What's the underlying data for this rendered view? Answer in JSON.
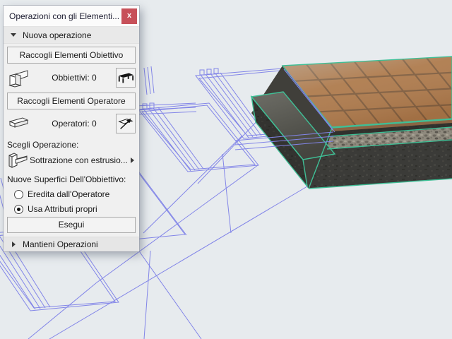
{
  "window": {
    "title": "Operazioni con gli Elementi...",
    "close_label": "x"
  },
  "panel": {
    "new_operation": {
      "header": "Nuova operazione",
      "collect_targets_button": "Raccogli Elementi Obiettivo",
      "targets_label": "Obbiettivi:",
      "targets_count": "0",
      "collect_operators_button": "Raccogli Elementi Operatore",
      "operators_label": "Operatori:",
      "operators_count": "0",
      "choose_operation_label": "Scegli Operazione:",
      "operation_value": "Sottrazione con estrusio...",
      "new_surfaces_label": "Nuove Superfici Dell'Obbiettivo:",
      "radio_options": [
        {
          "label": "Eredita dall'Operatore",
          "selected": false
        },
        {
          "label": "Usa Attributi propri",
          "selected": true
        }
      ],
      "execute_button": "Esegui"
    },
    "keep_operations": {
      "header": "Mantieni Operazioni"
    }
  },
  "viewport": {
    "background_color": "#e7ebee",
    "wireframe_color": "#8285e8",
    "selection_edge_color": "#3fbf96",
    "tile_color": "#b07a4a",
    "tile_grout_color": "#7d5a3c",
    "concrete_color": "#3b3b38",
    "gravel_color": "#8f8a7e",
    "description": "3D axonometric view: tiled terrace slab with concrete step shown shaded, surrounding stair elements shown as wireframe"
  }
}
